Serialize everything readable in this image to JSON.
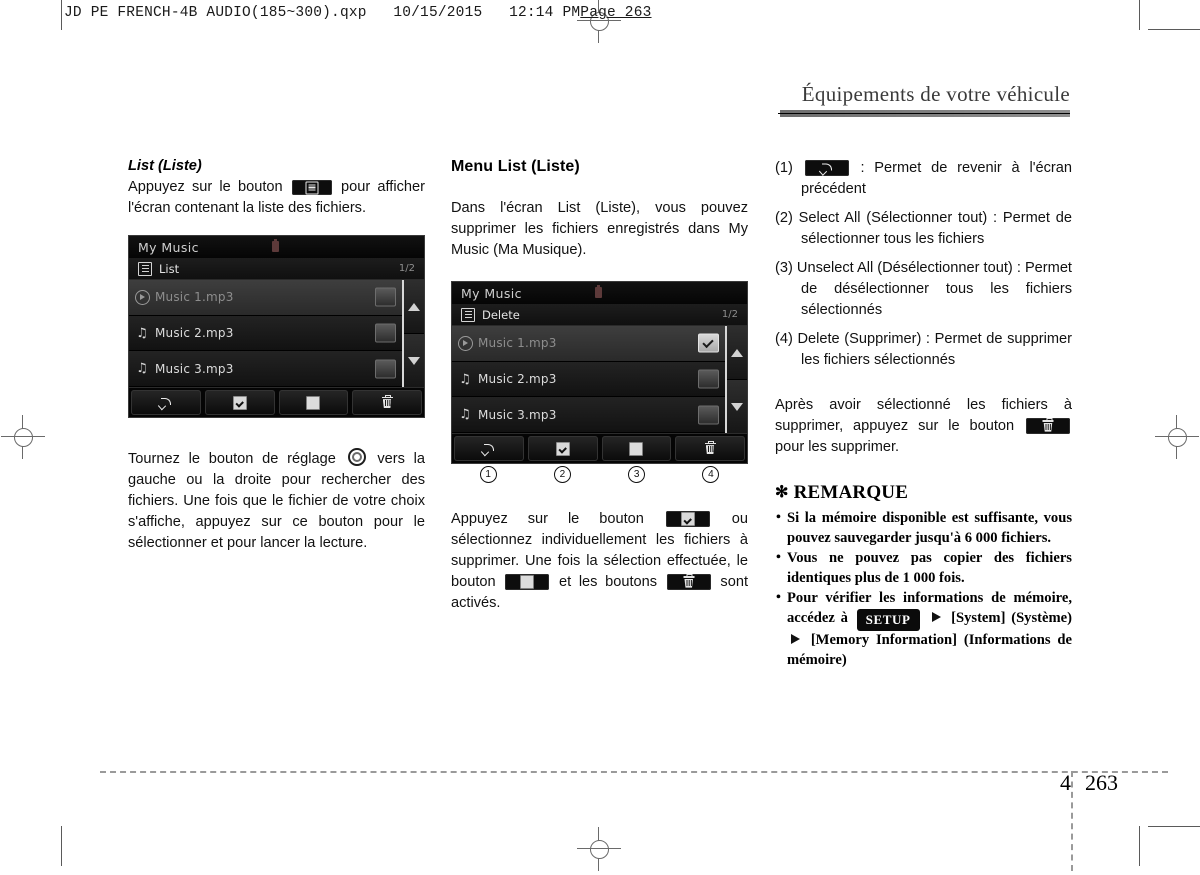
{
  "imprint": {
    "text": "JD PE FRENCH-4B AUDIO(185~300).qxp   10/15/2015   12:14 PM",
    "page_label": "Page 263"
  },
  "running_head": {
    "title": "Équipements de votre véhicule"
  },
  "footer": {
    "chapter": "4",
    "page": "263"
  },
  "col1": {
    "heading": "List (Liste)",
    "para1_a": "Appuyez sur le bouton",
    "para1_b": "pour afficher l'écran contenant la liste des fichiers.",
    "para2_a": "Tournez le bouton de réglage",
    "para2_b": "vers la gauche ou la droite pour rechercher des fichiers. Une fois que le fichier de votre choix s'affiche, appuyez sur ce bouton pour le sélectionner et pour lancer la lecture.",
    "screenshot": {
      "title": "My Music",
      "subtitle": "List",
      "page_indicator": "1/2",
      "rows": [
        {
          "name": "Music 1.mp3",
          "icon": "play-icon",
          "checked": false,
          "highlighted": true
        },
        {
          "name": "Music 2.mp3",
          "icon": "music-note-icon",
          "checked": false,
          "highlighted": false
        },
        {
          "name": "Music 3.mp3",
          "icon": "music-note-icon",
          "checked": false,
          "highlighted": false
        }
      ],
      "scroll": {
        "up": "arrow-up-icon",
        "down": "arrow-down-icon"
      },
      "buttons": [
        "back-icon",
        "select-all-icon",
        "unselect-all-icon",
        "delete-icon"
      ]
    }
  },
  "col2": {
    "heading": "Menu List (Liste)",
    "para1": "Dans l'écran List (Liste), vous pouvez supprimer les fichiers enregistrés dans My Music (Ma Musique).",
    "para2_a": "Appuyez sur le bouton",
    "para2_b": "ou sélectionnez individuellement les fichiers à supprimer. Une fois la sélection effectuée, le bouton",
    "para2_c": "et les boutons",
    "para2_d": "sont activés.",
    "screenshot": {
      "title": "My Music",
      "subtitle": "Delete",
      "page_indicator": "1/2",
      "rows": [
        {
          "name": "Music 1.mp3",
          "icon": "play-icon",
          "checked": true,
          "highlighted": true
        },
        {
          "name": "Music 2.mp3",
          "icon": "music-note-icon",
          "checked": false,
          "highlighted": false
        },
        {
          "name": "Music 3.mp3",
          "icon": "music-note-icon",
          "checked": false,
          "highlighted": false
        }
      ],
      "scroll": {
        "up": "arrow-up-icon",
        "down": "arrow-down-icon"
      },
      "buttons": [
        "back-icon",
        "select-all-icon",
        "unselect-all-icon",
        "delete-icon"
      ],
      "callouts": [
        "1",
        "2",
        "3",
        "4"
      ]
    }
  },
  "col3": {
    "items": [
      {
        "num": "(1)",
        "icon": "back-icon",
        "text": ": Permet de revenir à l'écran précédent"
      },
      {
        "num": "(2)",
        "icon": null,
        "text": "Select All (Sélectionner tout) : Permet de sélectionner tous les fichiers"
      },
      {
        "num": "(3)",
        "icon": null,
        "text": "Unselect All (Désélectionner tout) : Permet de désélectionner tous les fichiers sélectionnés"
      },
      {
        "num": "(4)",
        "icon": null,
        "text": "Delete (Supprimer) : Permet de supprimer les fichiers sélectionnés"
      }
    ],
    "para_a": "Après avoir sélectionné les fichiers à supprimer, appuyez sur le bouton",
    "para_b": "pour les supprimer.",
    "remark_title": "REMARQUE",
    "remark_star": "✻",
    "remarks": [
      "Si la mémoire disponible est suffisante, vous pouvez sauvegarder jusqu'à 6 000 fichiers.",
      "Vous ne pouvez pas copier des fichiers identiques plus de 1 000 fois."
    ],
    "remark3": {
      "a": "Pour vérifier les informations de mémoire, accédez à",
      "setup": "SETUP",
      "b": "[System] (Système)",
      "c": "[Memory Information] (Informations de mémoire)"
    }
  }
}
